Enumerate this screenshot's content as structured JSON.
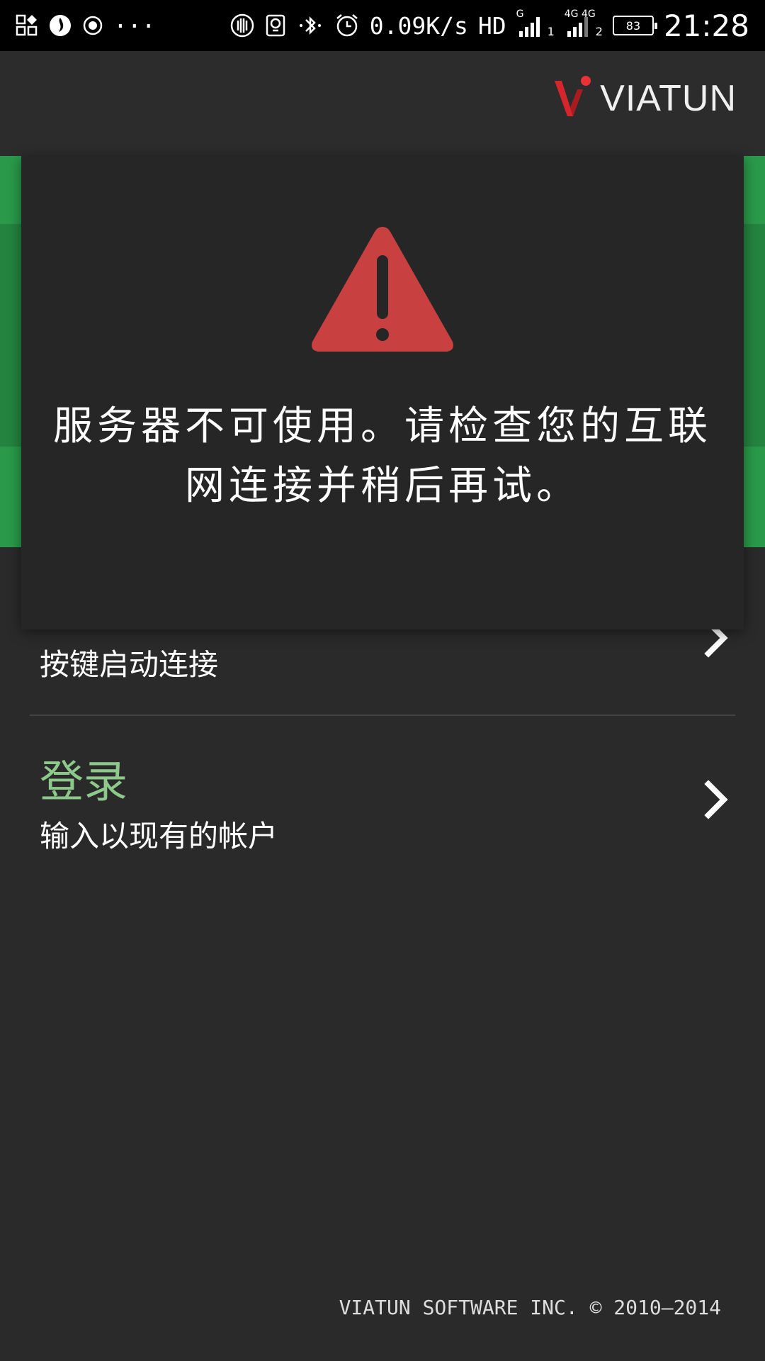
{
  "status_bar": {
    "left_icons": [
      "apps-icon",
      "flame-app-icon",
      "record-icon",
      "more-notifications-icon"
    ],
    "more_label": "···",
    "net_speed": "0.09K/s",
    "hd_label": "HD",
    "sim1_label": "1",
    "sim2_label": "2",
    "sim1_tech": "G",
    "sim2_tech": "4G 4G",
    "battery_level": "83",
    "time": "21:28"
  },
  "header": {
    "brand": "VIATUN",
    "logo_accent": "#d6262b"
  },
  "dialog": {
    "message": "服务器不可使用。请检查您的互联网连接并稍后再试。",
    "icon": "warning-icon",
    "icon_color": "#c94040"
  },
  "menu": {
    "items": [
      {
        "title": "",
        "subtitle": "按键启动连接"
      },
      {
        "title": "登录",
        "subtitle": "输入以现有的帐户"
      }
    ]
  },
  "footer": {
    "copyright": "VIATUN SOFTWARE INC. © 2010—2014"
  },
  "colors": {
    "banner_green": "#2a9a4a",
    "title_green": "#8cc98a",
    "background": "#2a2a2a"
  }
}
